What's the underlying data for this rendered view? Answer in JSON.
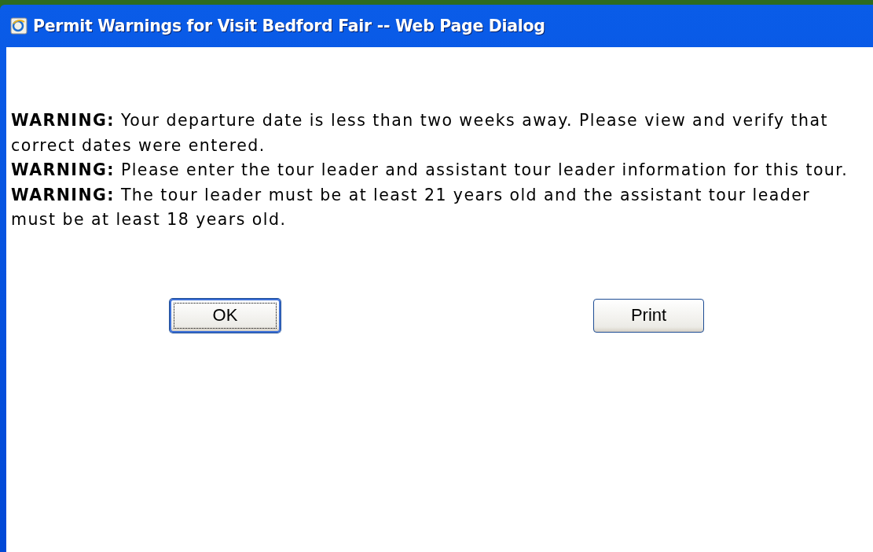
{
  "window": {
    "title": "Permit Warnings for Visit Bedford Fair -- Web Page Dialog"
  },
  "warnings": [
    "**WARNING:** Your departure date is less than two weeks away. Please view and verify that correct dates were entered.",
    "**WARNING:** Please enter the tour leader and assistant tour leader information for this tour.",
    "**WARNING:** The tour leader must be at least 21 years old and the assistant tour leader must be at least 18 years old."
  ],
  "buttons": [
    {
      "label": "OK",
      "focused": true
    },
    {
      "label": "Print",
      "focused": false
    }
  ]
}
